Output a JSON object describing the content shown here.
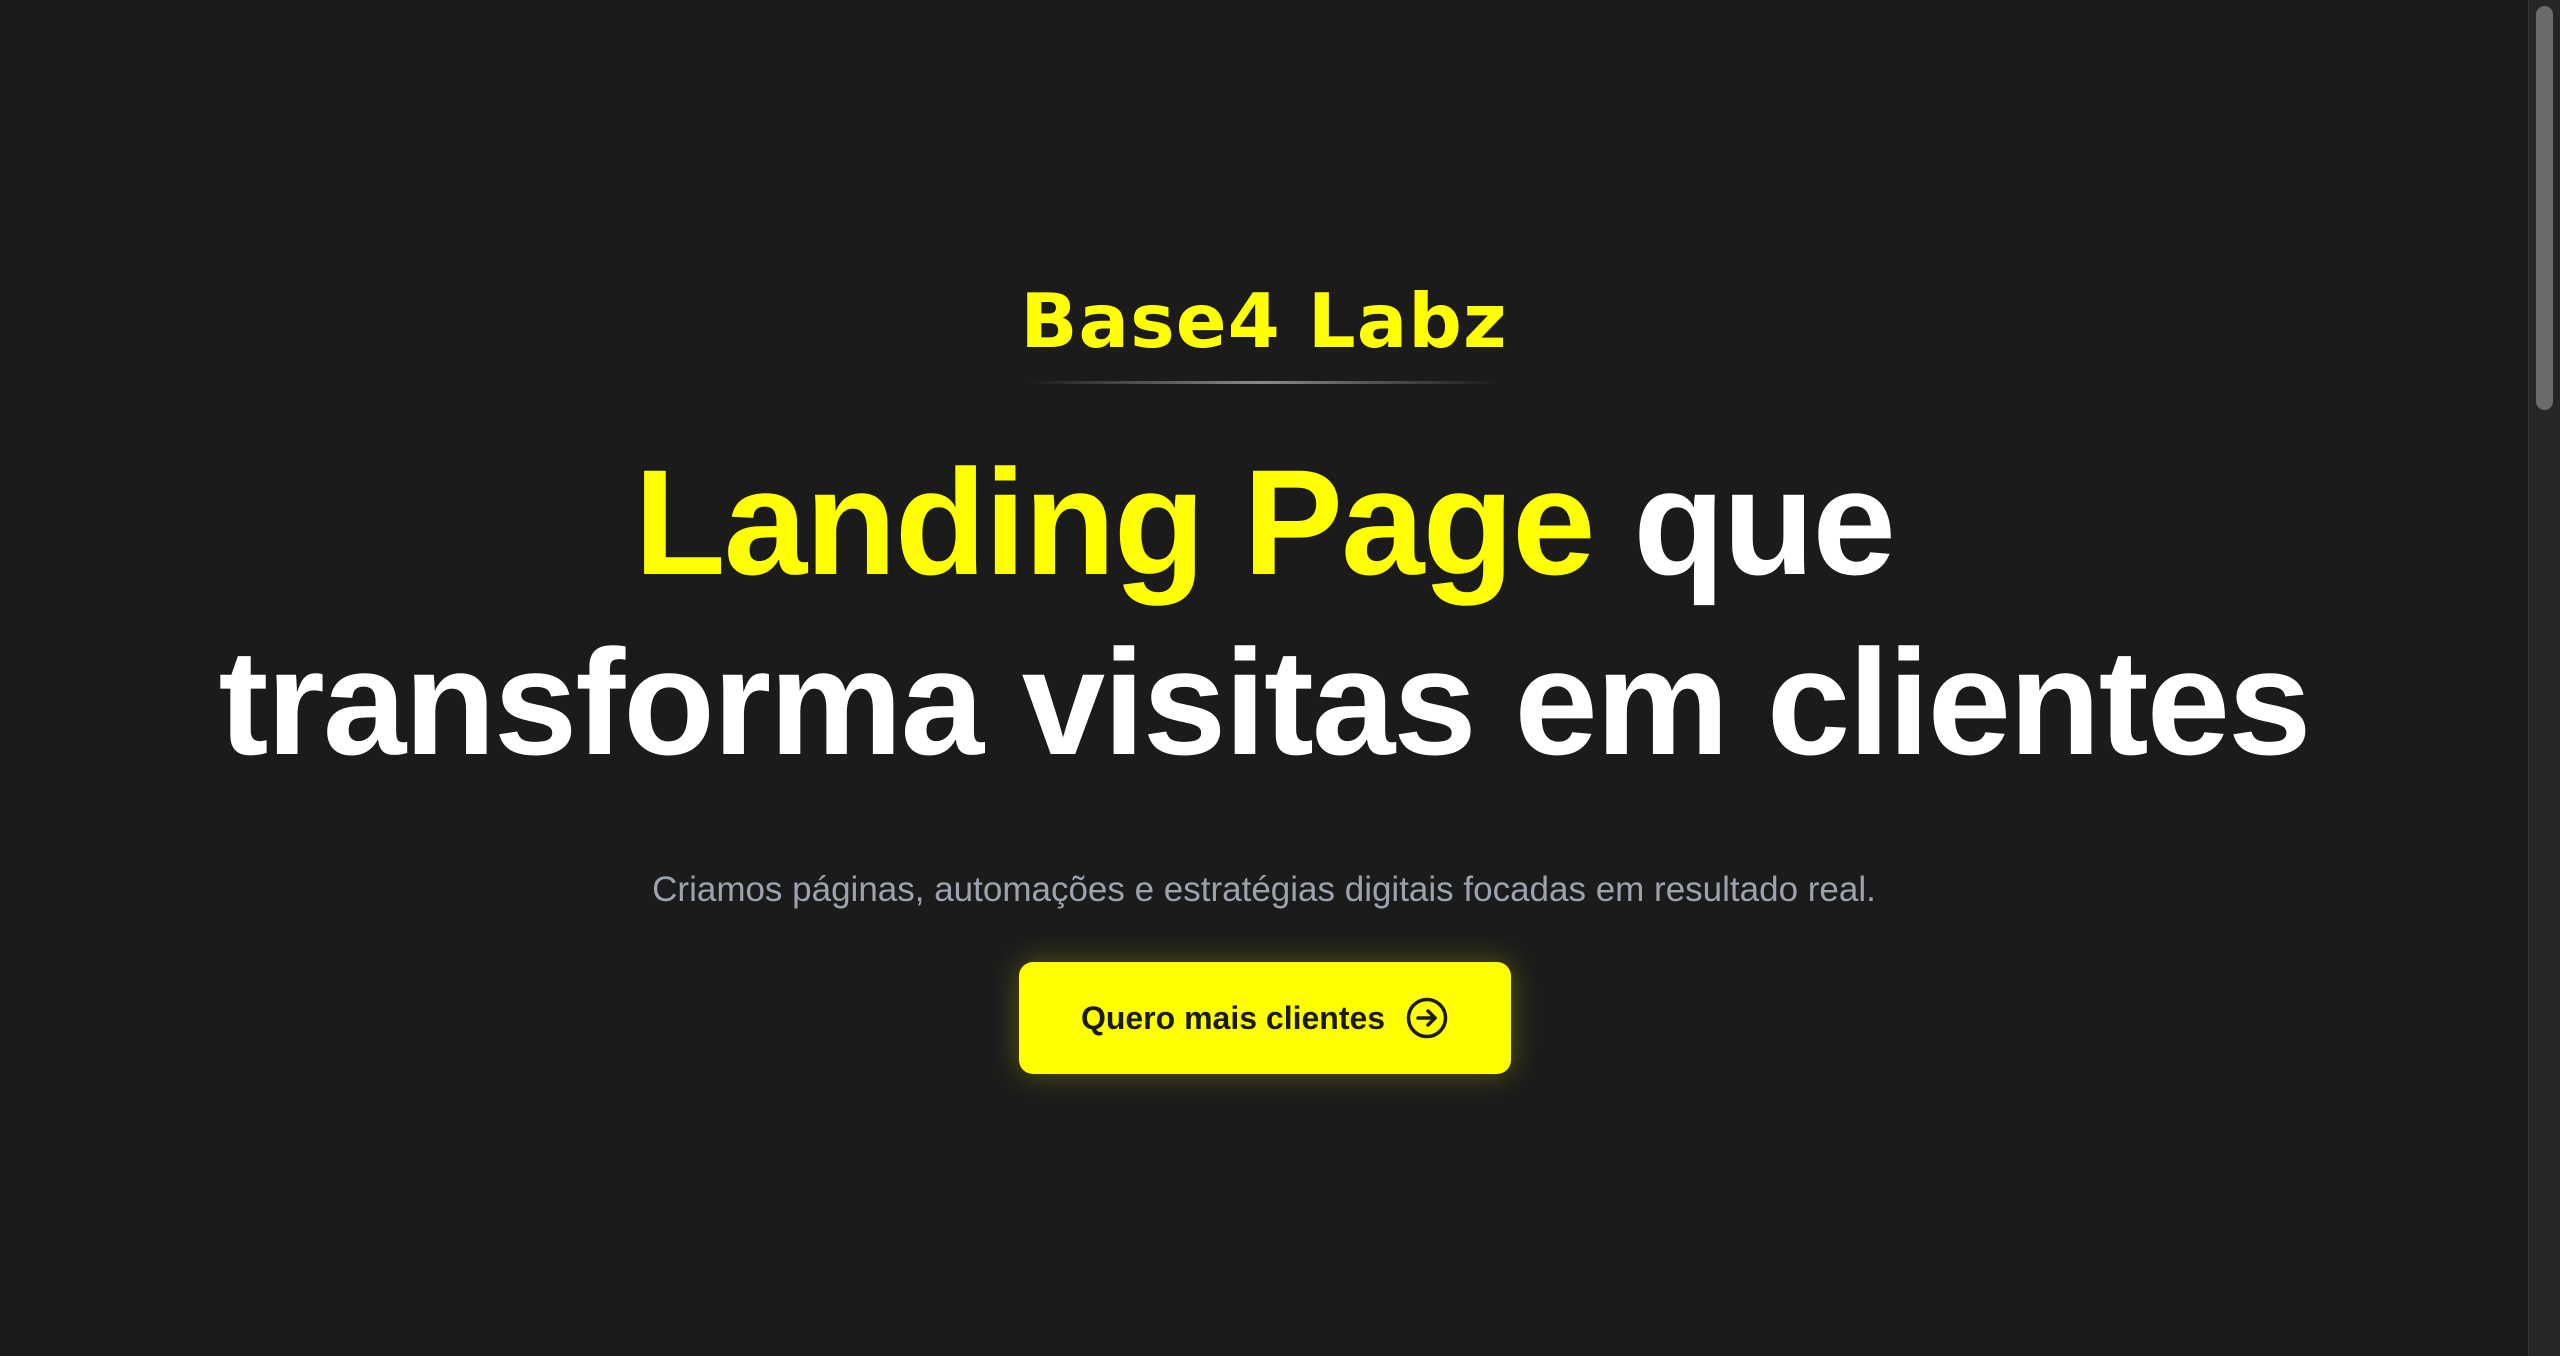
{
  "brand": {
    "name": "Base4 Labz",
    "color": "#ffff00"
  },
  "hero": {
    "headline_accent": "Landing Page",
    "headline_rest": "que",
    "headline_line2": "transforma visitas em clientes",
    "subtitle": "Criamos páginas, automações e estratégias digitais focadas em resultado real.",
    "cta_label": "Quero mais clientes",
    "cta_icon": "arrow-right-circle-icon"
  },
  "colors": {
    "background": "#1b1b1b",
    "accent": "#ffff00",
    "headline": "#ffffff",
    "subtitle": "#9ca3af",
    "cta_text": "#1a1a1a"
  }
}
